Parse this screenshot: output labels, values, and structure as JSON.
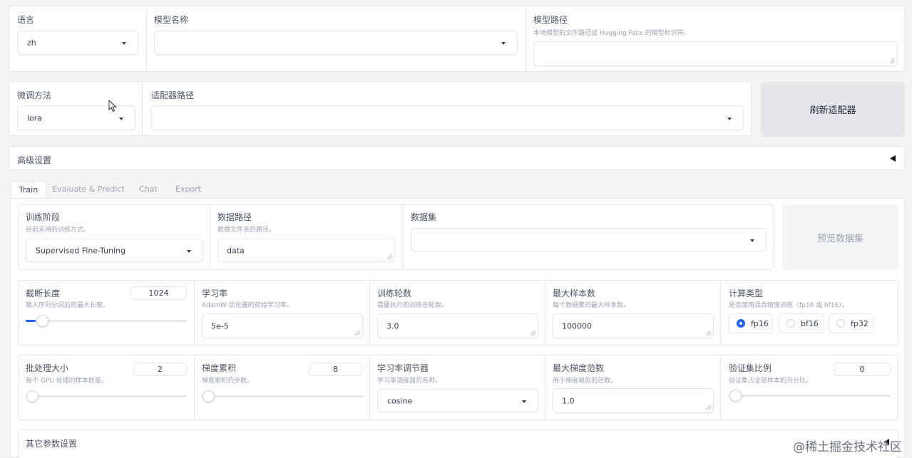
{
  "top": {
    "language": {
      "label": "语言",
      "value": "zh"
    },
    "model_name": {
      "label": "模型名称",
      "value": ""
    },
    "model_path": {
      "label": "模型路径",
      "hint": "本地模型的文件路径或 Hugging Face 的模型标识符。",
      "value": ""
    }
  },
  "finetune": {
    "method": {
      "label": "微调方法",
      "value": "lora"
    },
    "adapter_path": {
      "label": "适配器路径",
      "value": ""
    },
    "refresh_label": "刷新适配器"
  },
  "advanced": {
    "label": "高级设置",
    "toggle_icon": "triangle-left-icon"
  },
  "tabs": [
    {
      "label": "Train",
      "active": true
    },
    {
      "label": "Evaluate & Predict",
      "active": false
    },
    {
      "label": "Chat",
      "active": false
    },
    {
      "label": "Export",
      "active": false
    }
  ],
  "train": {
    "stage": {
      "label": "训练阶段",
      "hint": "目前采用的训练方式。",
      "value": "Supervised Fine-Tuning"
    },
    "dataset_dir": {
      "label": "数据路径",
      "hint": "数据文件夹的路径。",
      "value": "data"
    },
    "dataset": {
      "label": "数据集",
      "value": ""
    },
    "preview_label": "预览数据集",
    "cutoff_len": {
      "label": "截断长度",
      "hint": "输入序列分词后的最大长度。",
      "value": "1024",
      "fraction": 0.06
    },
    "learning_rate": {
      "label": "学习率",
      "hint": "AdamW 优化器的初始学习率。",
      "value": "5e-5"
    },
    "epochs": {
      "label": "训练轮数",
      "hint": "需要执行的训练总轮数。",
      "value": "3.0"
    },
    "max_samples": {
      "label": "最大样本数",
      "hint": "每个数据集的最大样本数。",
      "value": "100000"
    },
    "compute_type": {
      "label": "计算类型",
      "hint": "是否使用混合精度训练（fp16 或 bf16）。",
      "options": [
        "fp16",
        "bf16",
        "fp32"
      ],
      "selected": "fp16"
    },
    "batch_size": {
      "label": "批处理大小",
      "hint": "每个 GPU 处理的样本数量。",
      "value": "2",
      "fraction": 0.0
    },
    "grad_accum": {
      "label": "梯度累积",
      "hint": "梯度累积的步数。",
      "value": "8",
      "fraction": 0.0
    },
    "lr_scheduler": {
      "label": "学习率调节器",
      "hint": "学习率调度器的名称。",
      "value": "cosine"
    },
    "max_grad_norm": {
      "label": "最大梯度范数",
      "hint": "用于梯度裁剪的范数。",
      "value": "1.0"
    },
    "val_size": {
      "label": "验证集比例",
      "hint": "验证集占全部样本的百分比。",
      "value": "0",
      "fraction": 0.0
    },
    "other_params": {
      "label": "其它参数设置"
    }
  },
  "watermark": "@稀土掘金技术社区"
}
